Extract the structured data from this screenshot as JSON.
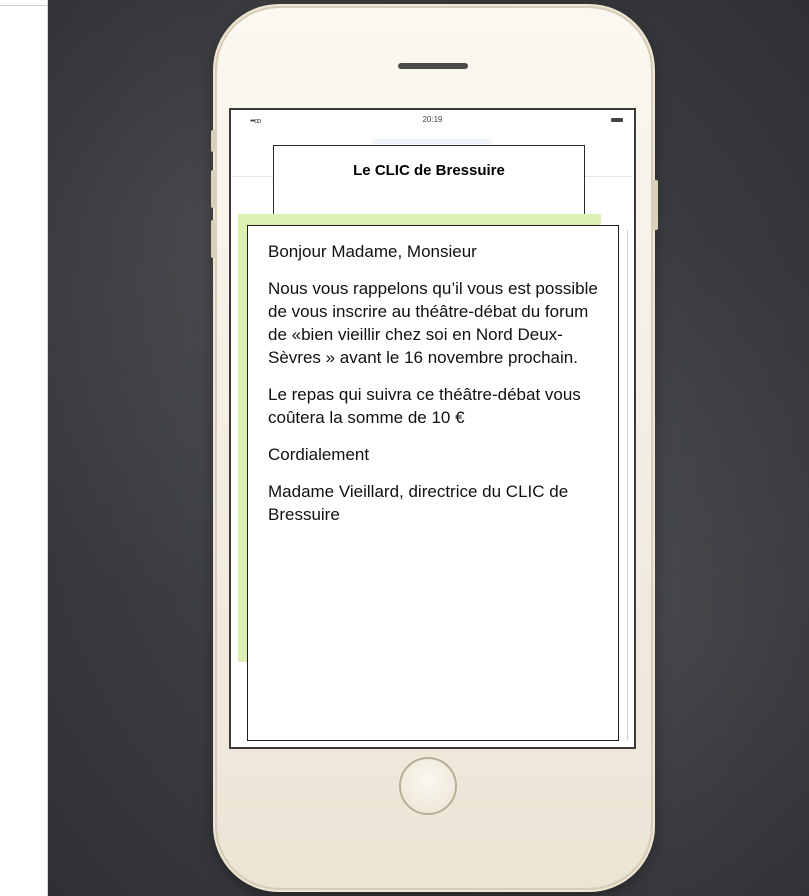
{
  "status_bar": {
    "signal": "•••oo",
    "time": "20:19"
  },
  "header": {
    "title": "Le CLIC de Bressuire"
  },
  "message": {
    "greeting": "Bonjour Madame, Monsieur",
    "paragraph_1": "Nous vous rappelons qu’il vous est possible de vous inscrire au théâtre-débat du forum de «bien vieillir chez soi en Nord Deux-Sèvres » avant le 16 novembre prochain.",
    "paragraph_2": "Le repas qui suivra ce théâtre-débat vous coûtera la somme de 10 €",
    "closing": "Cordialement",
    "signature": "Madame Vieillard, directrice du CLIC de Bressuire"
  },
  "colors": {
    "accent_green": "#ddf0b4",
    "board": "#3a3c3f",
    "phone_body": "#f3eee3"
  }
}
